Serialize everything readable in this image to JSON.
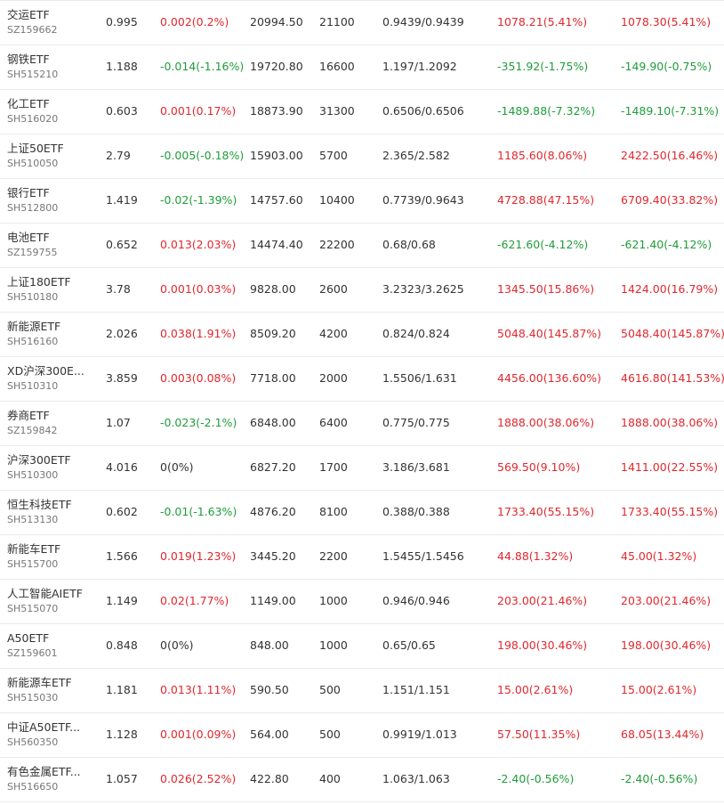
{
  "colors": {
    "up": "#e0282e",
    "down": "#1f9d3a",
    "flat": "#333333"
  },
  "holdings": [
    {
      "name": "交运ETF",
      "code": "SZ159662",
      "price": "0.995",
      "change": "0.002(0.2%)",
      "change_dir": "up",
      "market_value": "20994.50",
      "shares": "21100",
      "cost": "0.9439/0.9439",
      "profit": "1078.21(5.41%)",
      "profit_dir": "up",
      "total_profit": "1078.30(5.41%)",
      "total_dir": "up"
    },
    {
      "name": "钢铁ETF",
      "code": "SH515210",
      "price": "1.188",
      "change": "-0.014(-1.16%)",
      "change_dir": "down",
      "market_value": "19720.80",
      "shares": "16600",
      "cost": "1.197/1.2092",
      "profit": "-351.92(-1.75%)",
      "profit_dir": "down",
      "total_profit": "-149.90(-0.75%)",
      "total_dir": "down"
    },
    {
      "name": "化工ETF",
      "code": "SH516020",
      "price": "0.603",
      "change": "0.001(0.17%)",
      "change_dir": "up",
      "market_value": "18873.90",
      "shares": "31300",
      "cost": "0.6506/0.6506",
      "profit": "-1489.88(-7.32%)",
      "profit_dir": "down",
      "total_profit": "-1489.10(-7.31%)",
      "total_dir": "down"
    },
    {
      "name": "上证50ETF",
      "code": "SH510050",
      "price": "2.79",
      "change": "-0.005(-0.18%)",
      "change_dir": "down",
      "market_value": "15903.00",
      "shares": "5700",
      "cost": "2.365/2.582",
      "profit": "1185.60(8.06%)",
      "profit_dir": "up",
      "total_profit": "2422.50(16.46%)",
      "total_dir": "up"
    },
    {
      "name": "银行ETF",
      "code": "SH512800",
      "price": "1.419",
      "change": "-0.02(-1.39%)",
      "change_dir": "down",
      "market_value": "14757.60",
      "shares": "10400",
      "cost": "0.7739/0.9643",
      "profit": "4728.88(47.15%)",
      "profit_dir": "up",
      "total_profit": "6709.40(33.82%)",
      "total_dir": "up"
    },
    {
      "name": "电池ETF",
      "code": "SZ159755",
      "price": "0.652",
      "change": "0.013(2.03%)",
      "change_dir": "up",
      "market_value": "14474.40",
      "shares": "22200",
      "cost": "0.68/0.68",
      "profit": "-621.60(-4.12%)",
      "profit_dir": "down",
      "total_profit": "-621.40(-4.12%)",
      "total_dir": "down"
    },
    {
      "name": "上证180ETF",
      "code": "SH510180",
      "price": "3.78",
      "change": "0.001(0.03%)",
      "change_dir": "up",
      "market_value": "9828.00",
      "shares": "2600",
      "cost": "3.2323/3.2625",
      "profit": "1345.50(15.86%)",
      "profit_dir": "up",
      "total_profit": "1424.00(16.79%)",
      "total_dir": "up"
    },
    {
      "name": "新能源ETF",
      "code": "SH516160",
      "price": "2.026",
      "change": "0.038(1.91%)",
      "change_dir": "up",
      "market_value": "8509.20",
      "shares": "4200",
      "cost": "0.824/0.824",
      "profit": "5048.40(145.87%)",
      "profit_dir": "up",
      "total_profit": "5048.40(145.87%)",
      "total_dir": "up"
    },
    {
      "name": "XD沪深300E...",
      "code": "SH510310",
      "price": "3.859",
      "change": "0.003(0.08%)",
      "change_dir": "up",
      "market_value": "7718.00",
      "shares": "2000",
      "cost": "1.5506/1.631",
      "profit": "4456.00(136.60%)",
      "profit_dir": "up",
      "total_profit": "4616.80(141.53%)",
      "total_dir": "up"
    },
    {
      "name": "券商ETF",
      "code": "SZ159842",
      "price": "1.07",
      "change": "-0.023(-2.1%)",
      "change_dir": "down",
      "market_value": "6848.00",
      "shares": "6400",
      "cost": "0.775/0.775",
      "profit": "1888.00(38.06%)",
      "profit_dir": "up",
      "total_profit": "1888.00(38.06%)",
      "total_dir": "up"
    },
    {
      "name": "沪深300ETF",
      "code": "SH510300",
      "price": "4.016",
      "change": "0(0%)",
      "change_dir": "flat",
      "market_value": "6827.20",
      "shares": "1700",
      "cost": "3.186/3.681",
      "profit": "569.50(9.10%)",
      "profit_dir": "up",
      "total_profit": "1411.00(22.55%)",
      "total_dir": "up"
    },
    {
      "name": "恒生科技ETF",
      "code": "SH513130",
      "price": "0.602",
      "change": "-0.01(-1.63%)",
      "change_dir": "down",
      "market_value": "4876.20",
      "shares": "8100",
      "cost": "0.388/0.388",
      "profit": "1733.40(55.15%)",
      "profit_dir": "up",
      "total_profit": "1733.40(55.15%)",
      "total_dir": "up"
    },
    {
      "name": "新能车ETF",
      "code": "SH515700",
      "price": "1.566",
      "change": "0.019(1.23%)",
      "change_dir": "up",
      "market_value": "3445.20",
      "shares": "2200",
      "cost": "1.5455/1.5456",
      "profit": "44.88(1.32%)",
      "profit_dir": "up",
      "total_profit": "45.00(1.32%)",
      "total_dir": "up"
    },
    {
      "name": "人工智能AIETF",
      "code": "SH515070",
      "price": "1.149",
      "change": "0.02(1.77%)",
      "change_dir": "up",
      "market_value": "1149.00",
      "shares": "1000",
      "cost": "0.946/0.946",
      "profit": "203.00(21.46%)",
      "profit_dir": "up",
      "total_profit": "203.00(21.46%)",
      "total_dir": "up"
    },
    {
      "name": "A50ETF",
      "code": "SZ159601",
      "price": "0.848",
      "change": "0(0%)",
      "change_dir": "flat",
      "market_value": "848.00",
      "shares": "1000",
      "cost": "0.65/0.65",
      "profit": "198.00(30.46%)",
      "profit_dir": "up",
      "total_profit": "198.00(30.46%)",
      "total_dir": "up"
    },
    {
      "name": "新能源车ETF",
      "code": "SH515030",
      "price": "1.181",
      "change": "0.013(1.11%)",
      "change_dir": "up",
      "market_value": "590.50",
      "shares": "500",
      "cost": "1.151/1.151",
      "profit": "15.00(2.61%)",
      "profit_dir": "up",
      "total_profit": "15.00(2.61%)",
      "total_dir": "up"
    },
    {
      "name": "中证A50ETF...",
      "code": "SH560350",
      "price": "1.128",
      "change": "0.001(0.09%)",
      "change_dir": "up",
      "market_value": "564.00",
      "shares": "500",
      "cost": "0.9919/1.013",
      "profit": "57.50(11.35%)",
      "profit_dir": "up",
      "total_profit": "68.05(13.44%)",
      "total_dir": "up"
    },
    {
      "name": "有色金属ETF...",
      "code": "SH516650",
      "price": "1.057",
      "change": "0.026(2.52%)",
      "change_dir": "up",
      "market_value": "422.80",
      "shares": "400",
      "cost": "1.063/1.063",
      "profit": "-2.40(-0.56%)",
      "profit_dir": "down",
      "total_profit": "-2.40(-0.56%)",
      "total_dir": "down"
    }
  ]
}
